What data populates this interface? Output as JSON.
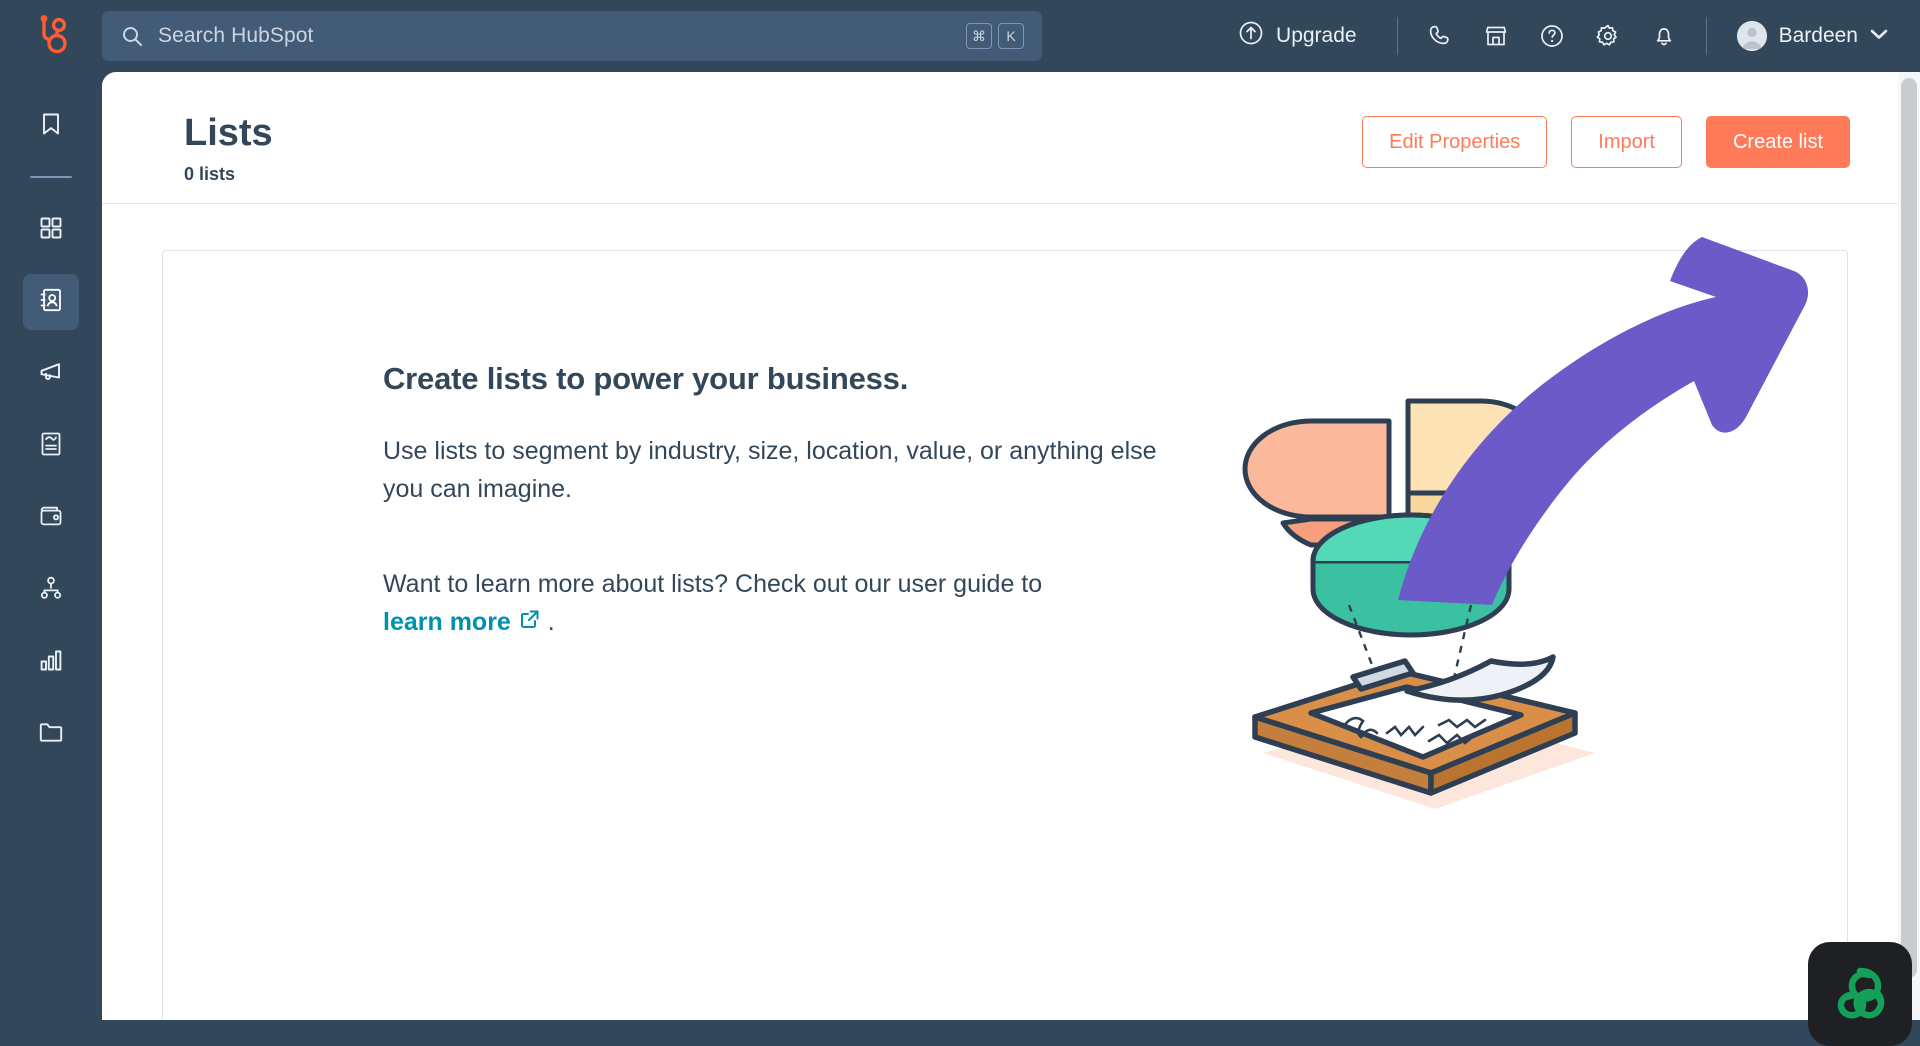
{
  "colors": {
    "nav_bg": "#33475b",
    "search_bg": "#425b76",
    "accent_orange": "#ff7a59",
    "link_teal": "#0091ae",
    "annotation_purple": "#6c5ac8",
    "text_dark": "#33475b",
    "border": "#dfe3eb",
    "pie_peach": "#fbb89b",
    "pie_cream": "#fde2b6",
    "pie_teal": "#4ccfb0",
    "clipboard_wood": "#d98f48",
    "bardeen_green": "#14a058"
  },
  "topnav": {
    "logo_icon": "hubspot-sprocket-logo",
    "search": {
      "icon": "search-icon",
      "placeholder": "Search HubSpot",
      "value": "",
      "shortcut_keys": [
        "⌘",
        "K"
      ]
    },
    "upgrade": {
      "label": "Upgrade",
      "icon": "upgrade-arrow-circle-icon"
    },
    "icons": [
      {
        "name": "phone-icon"
      },
      {
        "name": "marketplace-icon"
      },
      {
        "name": "help-icon"
      },
      {
        "name": "settings-gear-icon"
      },
      {
        "name": "notifications-bell-icon"
      }
    ],
    "account": {
      "name": "Bardeen",
      "avatar_icon": "user-avatar",
      "caret_icon": "chevron-down-icon"
    }
  },
  "sidebar": {
    "items": [
      {
        "name": "bookmarks",
        "icon": "bookmark-icon",
        "active": false
      },
      {
        "name": "workspaces",
        "icon": "grid-icon",
        "active": false
      },
      {
        "name": "contacts",
        "icon": "contacts-book-icon",
        "active": true
      },
      {
        "name": "marketing",
        "icon": "megaphone-icon",
        "active": false
      },
      {
        "name": "content",
        "icon": "content-page-icon",
        "active": false
      },
      {
        "name": "commerce",
        "icon": "wallet-icon",
        "active": false
      },
      {
        "name": "automation",
        "icon": "workflow-nodes-icon",
        "active": false
      },
      {
        "name": "reporting",
        "icon": "bar-chart-icon",
        "active": false
      },
      {
        "name": "library",
        "icon": "folder-icon",
        "active": false
      }
    ]
  },
  "page": {
    "title": "Lists",
    "subtitle": "0 lists",
    "buttons": [
      {
        "label": "Edit Properties",
        "style": "outline"
      },
      {
        "label": "Import",
        "style": "outline"
      },
      {
        "label": "Create list",
        "style": "primary"
      }
    ]
  },
  "empty_state": {
    "heading": "Create lists to power your business.",
    "body": "Use lists to segment by industry, size, location, value, or anything else you can imagine.",
    "learn_prefix": "Want to learn more about lists? Check out our user guide to",
    "learn_link": "learn more",
    "learn_link_icon": "external-link-icon",
    "learn_suffix": ".",
    "illustration": "exploded-pie-chart-and-clipboard"
  },
  "annotation": {
    "type": "curved-arrow",
    "points_to": "Create list",
    "color": "#6c5ac8"
  },
  "widget": {
    "name": "bardeen-extension-button",
    "icon": "bardeen-knot-logo"
  },
  "scrollbar": {
    "name": "page-scrollbar",
    "orientation": "vertical"
  }
}
